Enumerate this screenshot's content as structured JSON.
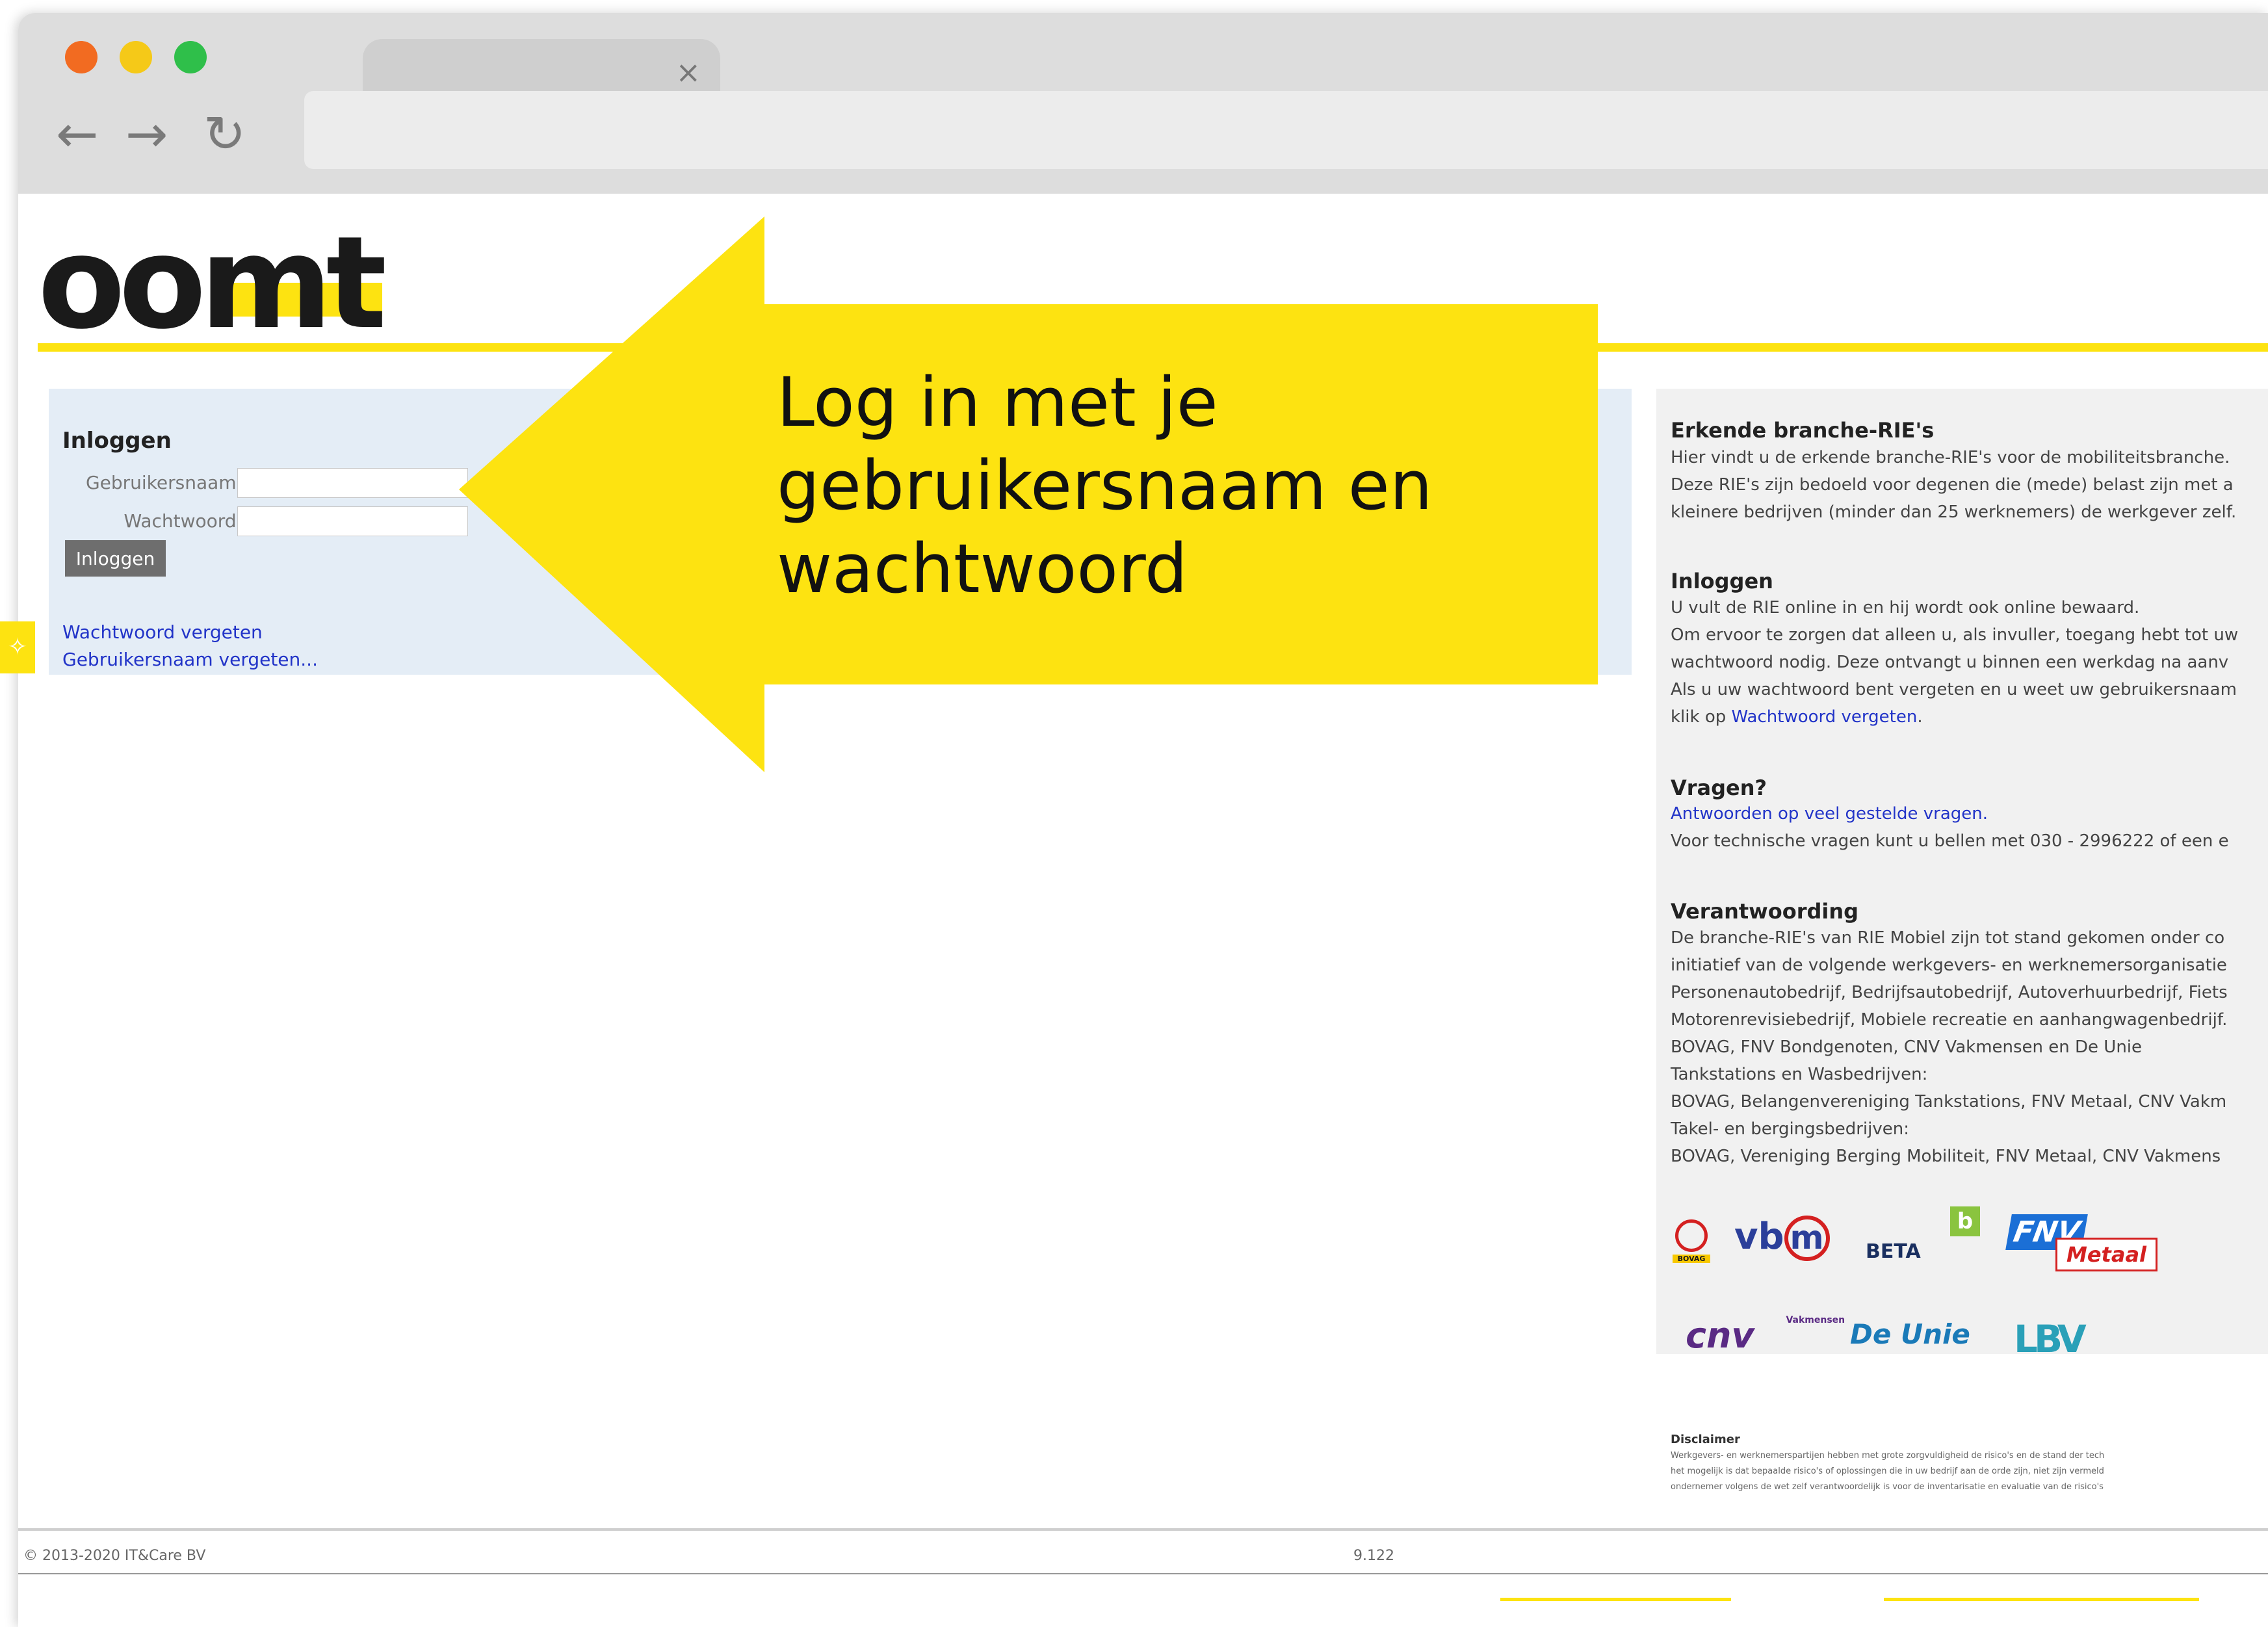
{
  "browser": {
    "tab_close": "×",
    "back": "←",
    "forward": "→",
    "reload": "↻"
  },
  "header": {
    "logo": "oomt"
  },
  "login": {
    "title": "Inloggen",
    "username_label": "Gebruikersnaam:",
    "password_label": "Wachtwoord:",
    "submit_label": "Inloggen",
    "forgot_password": "Wachtwoord vergeten",
    "forgot_username": "Gebruikersnaam vergeten..."
  },
  "callout": {
    "line1": "Log in met je",
    "line2": "gebruikersnaam en",
    "line3": "wachtwoord",
    "color": "#fde311"
  },
  "info": {
    "s1_title": "Erkende branche-RIE's",
    "s1_l1": "Hier vindt u de erkende branche-RIE's voor de mobiliteitsbranche.",
    "s1_l2": "Deze RIE's zijn bedoeld voor degenen die (mede) belast zijn met a",
    "s1_l3": "kleinere bedrijven (minder dan 25 werknemers) de werkgever zelf.",
    "s2_title": "Inloggen",
    "s2_l1": "U vult de RIE online in en hij wordt ook online bewaard.",
    "s2_l2": "Om ervoor te zorgen dat alleen u, als invuller, toegang hebt tot uw",
    "s2_l3": "wachtwoord nodig. Deze ontvangt u binnen een werkdag na aanv",
    "s2_l4": "Als u uw wachtwoord bent vergeten en u weet uw gebruikersnaam",
    "s2_l5_pre": "klik op ",
    "s2_l5_link": "Wachtwoord vergeten",
    "s2_l5_post": ".",
    "s3_title": "Vragen?",
    "s3_link": "Antwoorden op veel gestelde vragen.",
    "s3_l2": "Voor technische vragen kunt u bellen met 030 - 2996222 of een e",
    "s4_title": "Verantwoording",
    "s4_l1": "De branche-RIE's van RIE Mobiel zijn tot stand gekomen onder co",
    "s4_l2": "initiatief van de volgende werkgevers- en werknemersorganisatie",
    "s4_l3": "Personenautobedrijf, Bedrijfsautobedrijf, Autoverhuurbedrijf, Fiets",
    "s4_l4": "Motorenrevisiebedrijf, Mobiele recreatie en aanhangwagenbedrijf.",
    "s4_l5": "BOVAG, FNV Bondgenoten, CNV Vakmensen en De Unie",
    "s4_l6": "Tankstations en Wasbedrijven:",
    "s4_l7": "BOVAG, Belangenvereniging Tankstations, FNV Metaal, CNV Vakm",
    "s4_l8": "Takel- en bergingsbedrijven:",
    "s4_l9": "BOVAG, Vereniging Berging Mobiliteit, FNV Metaal, CNV Vakmens"
  },
  "logos": {
    "bovag": "BOVAG",
    "vbm": "vb",
    "vbm_m": "m",
    "beta": "BETA",
    "beta_b": "b",
    "fnv": "FNV",
    "fnv_metaal": "Metaal",
    "cnv": "cnv",
    "cnv_vakmensen": "Vakmensen",
    "deunie": "De Unie",
    "lbv": "LBV"
  },
  "disclaimer": {
    "title": "Disclaimer",
    "l1": "Werkgevers- en werknemerspartijen hebben met grote zorgvuldigheid de risico's en de stand der tech",
    "l2": "het mogelijk is dat bepaalde risico's of oplossingen die in uw bedrijf aan de orde zijn, niet zijn vermeld",
    "l3": "ondernemer volgens de wet zelf verantwoordelijk is voor de inventarisatie en evaluatie van de risico's"
  },
  "footer": {
    "copyright": "© 2013-2020 IT&Care BV",
    "version": "9.122"
  }
}
